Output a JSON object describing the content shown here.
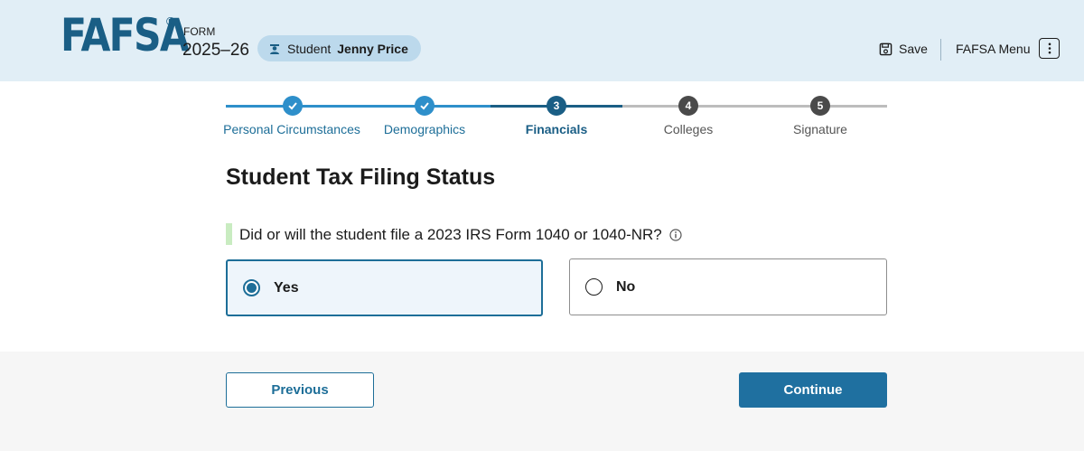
{
  "header": {
    "logo": "FAFSA",
    "registered_mark": "®",
    "form_label": "FORM",
    "form_year": "2025–26",
    "student_prefix": "Student",
    "student_name": "Jenny Price",
    "save_label": "Save",
    "menu_label": "FAFSA Menu"
  },
  "progress": {
    "steps": [
      {
        "label": "Personal Circumstances",
        "number": "1",
        "state": "complete"
      },
      {
        "label": "Demographics",
        "number": "2",
        "state": "complete"
      },
      {
        "label": "Financials",
        "number": "3",
        "state": "current"
      },
      {
        "label": "Colleges",
        "number": "4",
        "state": "upcoming"
      },
      {
        "label": "Signature",
        "number": "5",
        "state": "upcoming"
      }
    ]
  },
  "main": {
    "title": "Student Tax Filing Status",
    "question": "Did or will the student file a 2023 IRS Form 1040 or 1040-NR?",
    "options": [
      {
        "label": "Yes",
        "selected": true
      },
      {
        "label": "No",
        "selected": false
      }
    ]
  },
  "footer": {
    "previous_label": "Previous",
    "continue_label": "Continue"
  },
  "colors": {
    "brand": "#1a5e85",
    "accent": "#1d6e98",
    "complete": "#2e8fca",
    "upcoming": "#4a4a4a",
    "header_bg": "#e1eef6"
  },
  "icons": {
    "student": "student-icon",
    "save": "save-icon",
    "menu": "kebab-menu-icon",
    "info": "info-icon",
    "check": "check-icon"
  }
}
